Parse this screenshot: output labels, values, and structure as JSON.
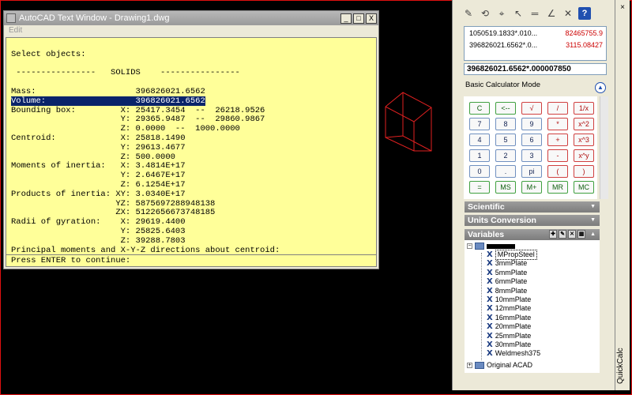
{
  "text_window": {
    "title": "AutoCAD Text Window - Drawing1.dwg",
    "menu": "Edit",
    "buttons": {
      "minimize": "_",
      "restore": "□",
      "close": "X"
    },
    "lines": [
      "",
      "Select objects:",
      "",
      " ----------------   SOLIDS    ----------------",
      "",
      "Mass:                    396826021.6562",
      "Volume:                  396826021.6562",
      "Bounding box:         X: 25417.3454  --  26218.9526",
      "                      Y: 29365.9487  --  29860.9867",
      "                      Z: 0.0000  --  1000.0000",
      "Centroid:             X: 25818.1490",
      "                      Y: 29613.4677",
      "                      Z: 500.0000",
      "Moments of inertia:   X: 3.4814E+17",
      "                      Y: 2.6467E+17",
      "                      Z: 6.1254E+17",
      "Products of inertia: XY: 3.0340E+17",
      "                     YZ: 5875697288948138",
      "                     ZX: 5122656673748185",
      "Radii of gyration:    X: 29619.4400",
      "                      Y: 25825.6403",
      "                      Z: 39288.7803",
      "Principal moments and X-Y-Z directions about centroid:"
    ],
    "highlight_index": 6,
    "prompt": "Press ENTER to continue:"
  },
  "quickcalc": {
    "title_vertical": "QuickCalc",
    "close": "×",
    "toolbar_icons": [
      "clear-icon",
      "history-icon",
      "get-coordinates-icon",
      "distance-icon",
      "angle-icon",
      "intersection-icon",
      "delete-icon",
      "help-icon"
    ],
    "toolbar_glyphs": [
      "✎",
      "⟲",
      "⌖",
      "↖",
      "═",
      "∠",
      "✕",
      "?"
    ],
    "history": [
      {
        "expr": "1050519.1833*.010...",
        "result": "82465755.9"
      },
      {
        "expr": "396826021.6562*.0...",
        "result": "3115.08427"
      }
    ],
    "input_value": "396826021.6562*.000007850",
    "mode_label": "Basic Calculator Mode",
    "keypad": [
      [
        "C",
        "<--",
        "√",
        "/",
        "1/x"
      ],
      [
        "7",
        "8",
        "9",
        "*",
        "x^2"
      ],
      [
        "4",
        "5",
        "6",
        "+",
        "x^3"
      ],
      [
        "1",
        "2",
        "3",
        "-",
        "x^y"
      ],
      [
        "0",
        ".",
        "pi",
        "(",
        ")"
      ],
      [
        "=",
        "MS",
        "M+",
        "MR",
        "MC"
      ]
    ],
    "sections": {
      "scientific": "Scientific",
      "units_conversion": "Units Conversion",
      "variables": "Variables"
    },
    "variables_tree": {
      "selected": "MPropSteel",
      "items": [
        "MPropSteel",
        "3mmPlate",
        "5mmPlate",
        "6mmPlate",
        "8mmPlate",
        "10mmPlate",
        "12mmPlate",
        "16mmPlate",
        "20mmPlate",
        "25mmPlate",
        "30mmPlate",
        "Weldmesh375"
      ],
      "other_root": "Original ACAD"
    }
  },
  "colors": {
    "text_window_bg": "#ffff99",
    "highlight_bg": "#0a246a",
    "wireframe": "#e02020",
    "border_accent": "#e01010"
  }
}
